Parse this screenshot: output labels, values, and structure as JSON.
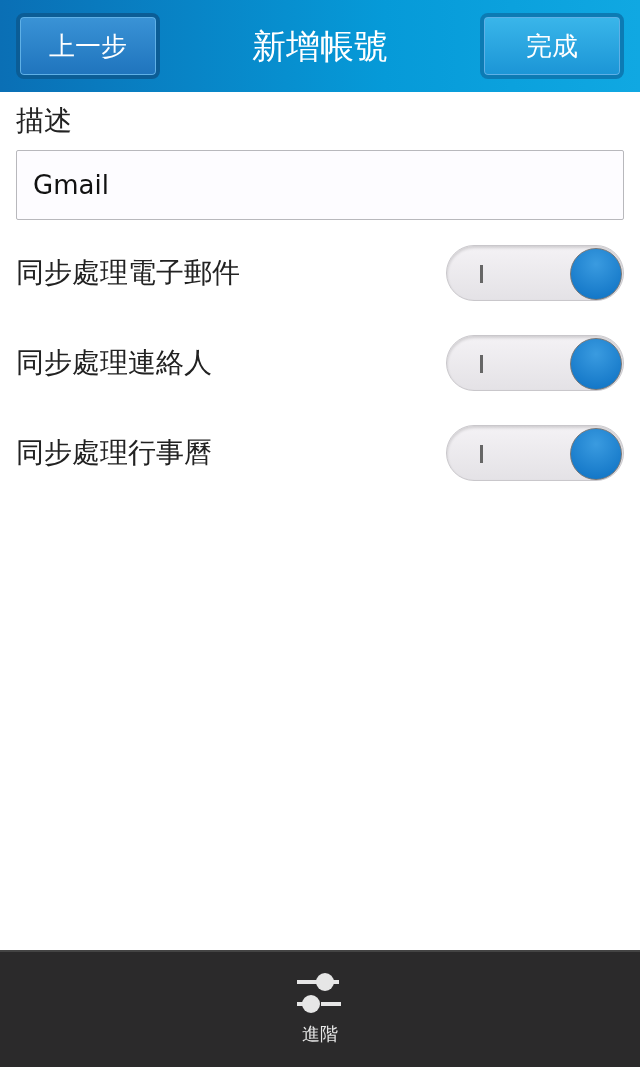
{
  "header": {
    "back_button": "上一步",
    "title": "新增帳號",
    "done_button": "完成"
  },
  "description": {
    "label": "描述",
    "value": "Gmail"
  },
  "toggles": [
    {
      "label": "同步處理電子郵件",
      "on": true
    },
    {
      "label": "同步處理連絡人",
      "on": true
    },
    {
      "label": "同步處理行事曆",
      "on": true
    }
  ],
  "bottom_bar": {
    "action": "進階"
  }
}
